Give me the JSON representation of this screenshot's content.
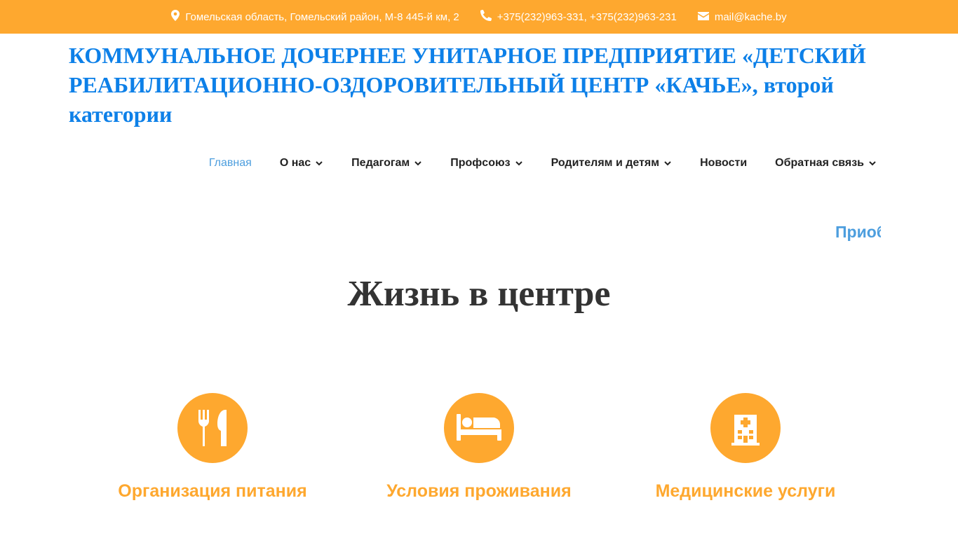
{
  "topbar": {
    "address": "Гомельская область, Гомельский район, М-8 445-й км, 2",
    "phones": "+375(232)963-331, +375(232)963-231",
    "email": "mail@kache.by"
  },
  "header": {
    "title": "КОММУНАЛЬНОЕ ДОЧЕРНЕЕ УНИТАРНОЕ ПРЕДПРИЯТИЕ «ДЕТСКИЙ РЕАБИЛИТАЦИОННО-ОЗДОРОВИТЕЛЬНЫЙ ЦЕНТР «КАЧЬЕ», второй категории"
  },
  "nav": {
    "items": [
      {
        "label": "Главная",
        "active": true
      },
      {
        "label": "О нас",
        "dropdown": true
      },
      {
        "label": "Педагогам",
        "dropdown": true
      },
      {
        "label": "Профсоюз",
        "dropdown": true
      },
      {
        "label": "Родителям и детям",
        "dropdown": true
      },
      {
        "label": "Новости"
      },
      {
        "label": "Обратная связь",
        "dropdown": true
      }
    ]
  },
  "marquee": {
    "text": "Приоб"
  },
  "section": {
    "title": "Жизнь в центре"
  },
  "features": [
    {
      "icon": "utensils-icon",
      "label": "Организация питания"
    },
    {
      "icon": "bed-icon",
      "label": "Условия проживания"
    },
    {
      "icon": "hospital-icon",
      "label": "Медицинские услуги"
    }
  ],
  "colors": {
    "accent": "#fea82f",
    "title_blue": "#0d80e8",
    "link_blue": "#4d9ede"
  }
}
